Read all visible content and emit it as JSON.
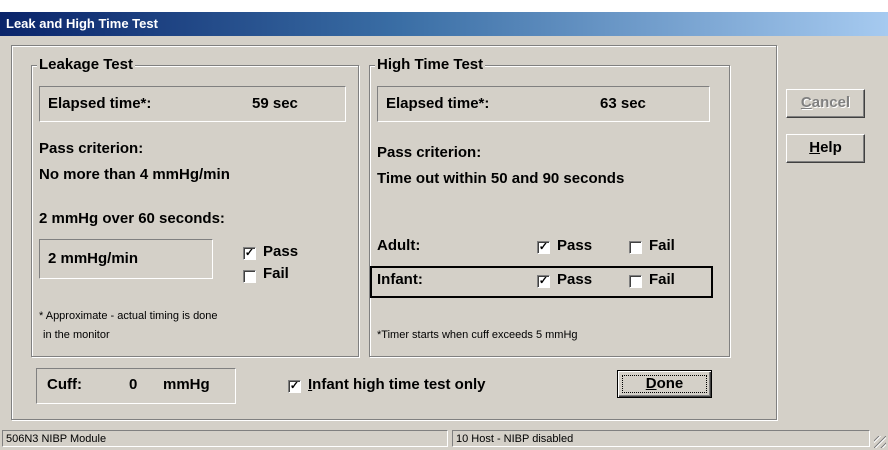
{
  "window": {
    "title": "Leak and High Time Test"
  },
  "leakage": {
    "legend": "Leakage Test",
    "elapsed_label": "Elapsed  time*:",
    "elapsed_value": "59 sec",
    "criterion_label": "Pass criterion:",
    "criterion_text": "No more than 4 mmHg/min",
    "measure_label": "2 mmHg over 60 seconds:",
    "rate_value": "2 mmHg/min",
    "pass_label": "Pass",
    "pass_checked": true,
    "fail_label": "Fail",
    "fail_checked": false,
    "footnote_1": "* Approximate - actual timing is done",
    "footnote_2": "in the monitor"
  },
  "hightime": {
    "legend": "High Time Test",
    "elapsed_label": "Elapsed time*:",
    "elapsed_value": "63 sec",
    "criterion_label": "Pass criterion:",
    "criterion_text": "Time out within 50 and 90 seconds",
    "adult_label": "Adult:",
    "adult_pass_label": "Pass",
    "adult_pass_checked": true,
    "adult_fail_label": "Fail",
    "adult_fail_checked": false,
    "infant_label": "Infant:",
    "infant_pass_label": "Pass",
    "infant_pass_checked": true,
    "infant_fail_label": "Fail",
    "infant_fail_checked": false,
    "footnote": "*Timer starts when cuff exceeds 5 mmHg"
  },
  "cuff": {
    "label": "Cuff:",
    "value": "0",
    "unit": "mmHg"
  },
  "infant_only": {
    "checked": true,
    "accel": "I",
    "rest": "nfant high time test only"
  },
  "buttons": {
    "done_accel": "D",
    "done_rest": "one",
    "cancel_accel": "C",
    "cancel_rest": "ancel",
    "help_accel": "H",
    "help_rest": "elp"
  },
  "status": {
    "left": "506N3 NIBP Module",
    "right": "10 Host - NIBP disabled"
  },
  "check_mark": "✓"
}
